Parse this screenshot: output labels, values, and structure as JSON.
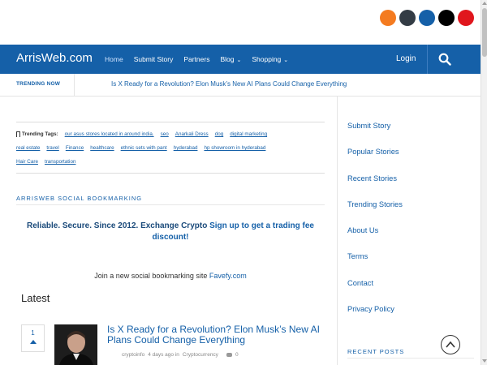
{
  "social": {
    "icons": [
      {
        "name": "social-icon-1",
        "color": "#f47b20"
      },
      {
        "name": "social-icon-2",
        "color": "#333c45"
      },
      {
        "name": "social-icon-3",
        "color": "#1560a8"
      },
      {
        "name": "social-icon-4",
        "color": "#000000"
      },
      {
        "name": "social-icon-5",
        "color": "#e0161d"
      }
    ]
  },
  "nav": {
    "brand": "ArrisWeb.com",
    "items": [
      {
        "label": "Home",
        "active": true
      },
      {
        "label": "Submit Story"
      },
      {
        "label": "Partners"
      },
      {
        "label": "Blog",
        "dropdown": true
      },
      {
        "label": "Shopping",
        "dropdown": true
      }
    ],
    "login": "Login",
    "search_icon": "search-icon"
  },
  "trending": {
    "label": "TRENDING NOW",
    "headline": "Is X Ready for a Revolution? Elon Musk’s New AI Plans Could Change Everything"
  },
  "tags": {
    "title": "Trending Tags:",
    "row1": [
      "our asus stores located in around india.",
      "seo",
      "Anarkali Dress",
      "dog",
      "digital marketing"
    ],
    "row2": [
      "real estate",
      "travel",
      "Finance",
      "healthcare",
      "ethnic sets with pant",
      "hyderabad",
      "hp showroom in hyderabad"
    ],
    "row3": [
      "Hair Care",
      "transportation"
    ]
  },
  "section": {
    "heading": "ARRISWEB SOCIAL BOOKMARKING"
  },
  "promo": {
    "text": "Reliable. Secure. Since 2012. Exchange Crypto",
    "link": "Sign up to get a trading fee discount!"
  },
  "join": {
    "text": "Join a new social bookmarking site",
    "link": "Favefy.com"
  },
  "latest": {
    "heading": "Latest",
    "post": {
      "votes": "1",
      "title": "Is X Ready for a Revolution? Elon Musk’s New AI Plans Could Change Everything",
      "author": "cryptoinfo",
      "time": "4 days ago in",
      "category": "Cryptocurrency",
      "comments": "0"
    }
  },
  "sidebar": {
    "links": [
      "Submit Story",
      "Popular Stories",
      "Recent Stories",
      "Trending Stories",
      "About Us",
      "Terms",
      "Contact",
      "Privacy Policy"
    ],
    "recent_heading": "RECENT POSTS"
  },
  "colors": {
    "brand": "#1560a8"
  }
}
